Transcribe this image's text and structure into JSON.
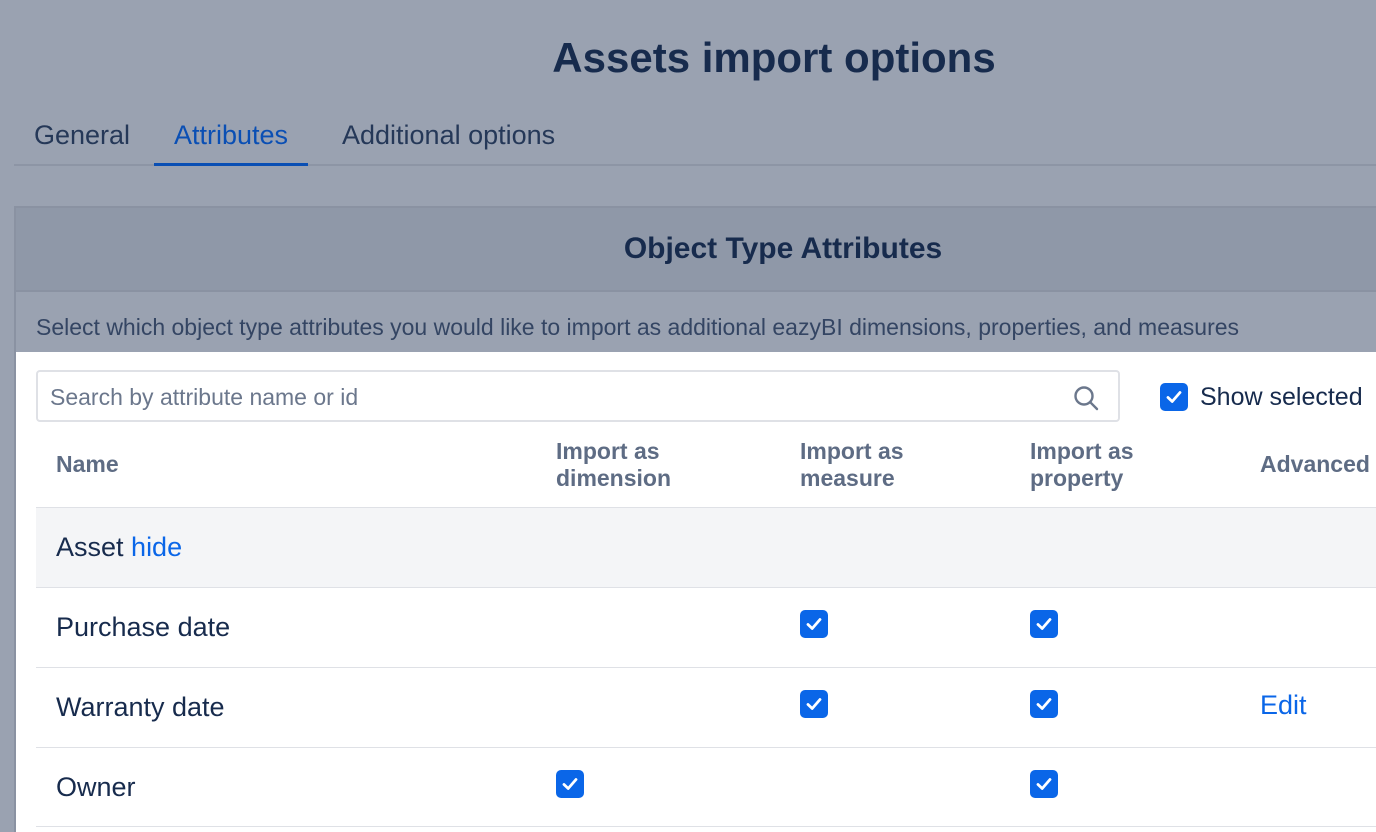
{
  "page": {
    "title": "Assets import options"
  },
  "tabs": [
    {
      "label": "General",
      "active": false
    },
    {
      "label": "Attributes",
      "active": true
    },
    {
      "label": "Additional options",
      "active": false
    }
  ],
  "panel": {
    "title": "Object Type Attributes",
    "description": "Select which object type attributes you would like to import as additional eazyBI dimensions, properties, and measures"
  },
  "search": {
    "placeholder": "Search by attribute name or id",
    "value": ""
  },
  "show_selected": {
    "label": "Show selected",
    "checked": true
  },
  "columns": {
    "name": "Name",
    "dimension": [
      "Import as",
      "dimension"
    ],
    "measure": [
      "Import as",
      "measure"
    ],
    "property": [
      "Import as",
      "property"
    ],
    "advanced": "Advanced"
  },
  "group": {
    "label": "Asset",
    "toggle": "hide"
  },
  "rows": [
    {
      "name": "Purchase date",
      "dimension": false,
      "measure": true,
      "property": true,
      "advanced": ""
    },
    {
      "name": "Warranty date",
      "dimension": false,
      "measure": true,
      "property": true,
      "advanced": "Edit"
    },
    {
      "name": "Owner",
      "dimension": true,
      "measure": false,
      "property": true,
      "advanced": ""
    }
  ],
  "colors": {
    "accent": "#0a66e8",
    "overlay": "#9aa2b1",
    "text": "#172b4d"
  }
}
